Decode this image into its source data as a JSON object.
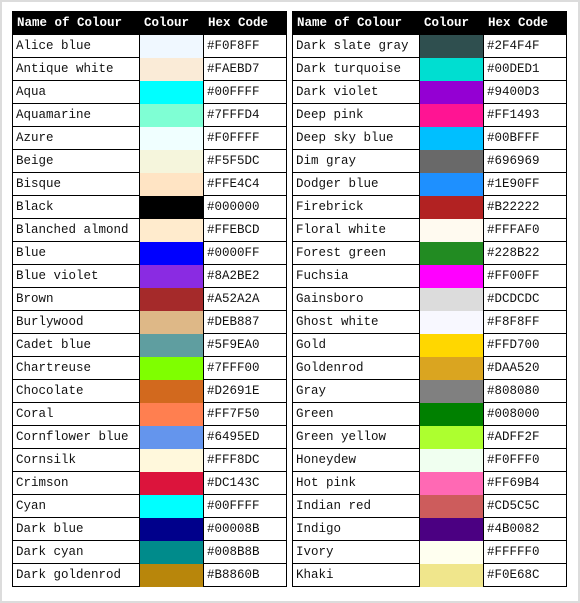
{
  "headers": {
    "name": "Name of Colour",
    "colour": "Colour",
    "hex": "Hex Code"
  },
  "tables": [
    {
      "rows": [
        {
          "name": "Alice blue",
          "hex": "#F0F8FF",
          "color": "#F0F8FF"
        },
        {
          "name": "Antique white",
          "hex": "#FAEBD7",
          "color": "#FAEBD7"
        },
        {
          "name": "Aqua",
          "hex": "#00FFFF",
          "color": "#00FFFF"
        },
        {
          "name": "Aquamarine",
          "hex": "#7FFFD4",
          "color": "#7FFFD4"
        },
        {
          "name": "Azure",
          "hex": "#F0FFFF",
          "color": "#F0FFFF"
        },
        {
          "name": "Beige",
          "hex": "#F5F5DC",
          "color": "#F5F5DC"
        },
        {
          "name": "Bisque",
          "hex": "#FFE4C4",
          "color": "#FFE4C4"
        },
        {
          "name": "Black",
          "hex": "#000000",
          "color": "#000000"
        },
        {
          "name": "Blanched almond",
          "hex": "#FFEBCD",
          "color": "#FFEBCD"
        },
        {
          "name": "Blue",
          "hex": "#0000FF",
          "color": "#0000FF"
        },
        {
          "name": "Blue violet",
          "hex": "#8A2BE2",
          "color": "#8A2BE2"
        },
        {
          "name": "Brown",
          "hex": "#A52A2A",
          "color": "#A52A2A"
        },
        {
          "name": "Burlywood",
          "hex": "#DEB887",
          "color": "#DEB887"
        },
        {
          "name": "Cadet blue",
          "hex": "#5F9EA0",
          "color": "#5F9EA0"
        },
        {
          "name": "Chartreuse",
          "hex": "#7FFF00",
          "color": "#7FFF00"
        },
        {
          "name": "Chocolate",
          "hex": "#D2691E",
          "color": "#D2691E"
        },
        {
          "name": "Coral",
          "hex": "#FF7F50",
          "color": "#FF7F50"
        },
        {
          "name": "Cornflower blue",
          "hex": "#6495ED",
          "color": "#6495ED"
        },
        {
          "name": "Cornsilk",
          "hex": "#FFF8DC",
          "color": "#FFF8DC"
        },
        {
          "name": "Crimson",
          "hex": "#DC143C",
          "color": "#DC143C"
        },
        {
          "name": "Cyan",
          "hex": "#00FFFF",
          "color": "#00FFFF"
        },
        {
          "name": "Dark blue",
          "hex": "#00008B",
          "color": "#00008B"
        },
        {
          "name": "Dark cyan",
          "hex": "#008B8B",
          "color": "#008B8B"
        },
        {
          "name": "Dark goldenrod",
          "hex": "#B8860B",
          "color": "#B8860B"
        }
      ]
    },
    {
      "rows": [
        {
          "name": "Dark slate gray",
          "hex": "#2F4F4F",
          "color": "#2F4F4F"
        },
        {
          "name": "Dark turquoise",
          "hex": "#00DED1",
          "color": "#00DED1"
        },
        {
          "name": "Dark violet",
          "hex": "#9400D3",
          "color": "#9400D3"
        },
        {
          "name": "Deep pink",
          "hex": "#FF1493",
          "color": "#FF1493"
        },
        {
          "name": "Deep sky blue",
          "hex": "#00BFFF",
          "color": "#00BFFF"
        },
        {
          "name": "Dim gray",
          "hex": "#696969",
          "color": "#696969"
        },
        {
          "name": "Dodger blue",
          "hex": "#1E90FF",
          "color": "#1E90FF"
        },
        {
          "name": "Firebrick",
          "hex": "#B22222",
          "color": "#B22222"
        },
        {
          "name": "Floral white",
          "hex": "#FFFAF0",
          "color": "#FFFAF0"
        },
        {
          "name": "Forest green",
          "hex": "#228B22",
          "color": "#228B22"
        },
        {
          "name": "Fuchsia",
          "hex": "#FF00FF",
          "color": "#FF00FF"
        },
        {
          "name": "Gainsboro",
          "hex": "#DCDCDC",
          "color": "#DCDCDC"
        },
        {
          "name": "Ghost white",
          "hex": "#F8F8FF",
          "color": "#F8F8FF"
        },
        {
          "name": "Gold",
          "hex": "#FFD700",
          "color": "#FFD700"
        },
        {
          "name": "Goldenrod",
          "hex": "#DAA520",
          "color": "#DAA520"
        },
        {
          "name": "Gray",
          "hex": "#808080",
          "color": "#808080"
        },
        {
          "name": "Green",
          "hex": "#008000",
          "color": "#008000"
        },
        {
          "name": "Green yellow",
          "hex": "#ADFF2F",
          "color": "#ADFF2F"
        },
        {
          "name": "Honeydew",
          "hex": "#F0FFF0",
          "color": "#F0FFF0"
        },
        {
          "name": "Hot pink",
          "hex": "#FF69B4",
          "color": "#FF69B4"
        },
        {
          "name": "Indian red",
          "hex": "#CD5C5C",
          "color": "#CD5C5C"
        },
        {
          "name": "Indigo",
          "hex": "#4B0082",
          "color": "#4B0082"
        },
        {
          "name": "Ivory",
          "hex": "#FFFFF0",
          "color": "#FFFFF0"
        },
        {
          "name": "Khaki",
          "hex": "#F0E68C",
          "color": "#F0E68C"
        }
      ]
    }
  ]
}
